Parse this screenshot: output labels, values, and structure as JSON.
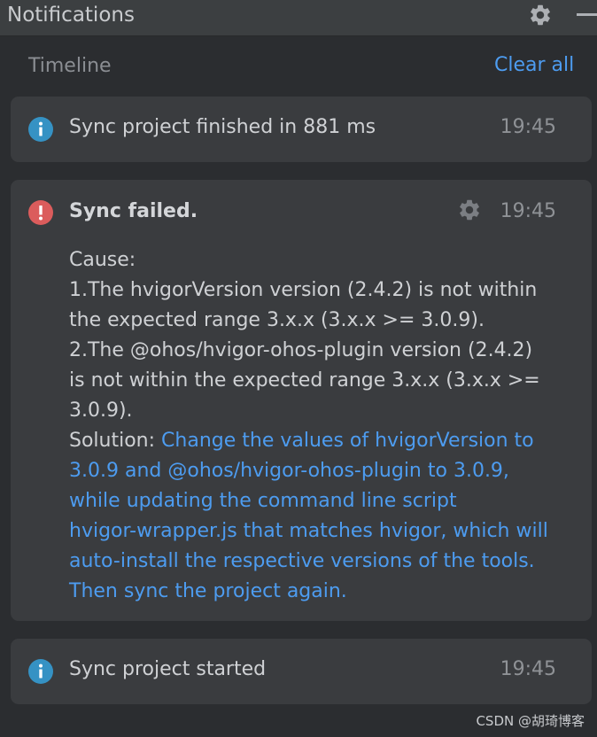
{
  "header": {
    "title": "Notifications"
  },
  "toolbar": {
    "timeline_label": "Timeline",
    "clear_all": "Clear all"
  },
  "notifications": [
    {
      "type": "info",
      "icon": "info-icon",
      "message": "Sync project finished in 881 ms",
      "time": "19:45"
    },
    {
      "type": "error",
      "icon": "error-icon",
      "title": "Sync failed.",
      "time": "19:45",
      "lines": [
        "Cause:",
        "1.The hvigorVersion version (2.4.2) is not within",
        "the expected range 3.x.x (3.x.x >= 3.0.9).",
        "2.The @ohos/hvigor-ohos-plugin version (2.4.2)",
        "is not within the expected range 3.x.x (3.x.x >=",
        "3.0.9)."
      ],
      "solution_label": "Solution: ",
      "solution_lines": [
        "Change the values of hvigorVersion to",
        "3.0.9 and @ohos/hvigor-ohos-plugin to 3.0.9,",
        "while updating the command line script",
        "hvigor-wrapper.js that matches hvigor, which will",
        "auto-install the respective versions of the tools.",
        "Then sync the project again."
      ]
    },
    {
      "type": "info",
      "icon": "info-icon",
      "message": "Sync project started",
      "time": "19:45"
    }
  ],
  "watermark": "CSDN @胡琦博客",
  "colors": {
    "background": "#2b2d30",
    "card": "#3a3c3f",
    "link": "#4d9cf0",
    "info": "#3592c4",
    "error": "#db5c5c"
  }
}
